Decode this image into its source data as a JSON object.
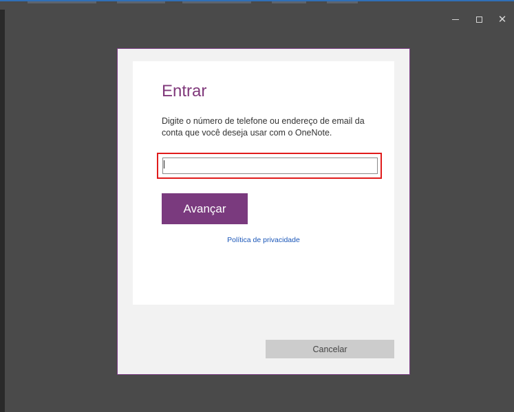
{
  "window": {
    "controls": {
      "minimize": "minimize-icon",
      "maximize": "maximize-icon",
      "close": "close-icon"
    }
  },
  "signin": {
    "title": "Entrar",
    "description": "Digite o número de telefone ou endereço de email da conta que você deseja usar com o OneNote.",
    "input_value": "",
    "next_label": "Avançar",
    "privacy_label": "Política de privacidade",
    "cancel_label": "Cancelar"
  },
  "colors": {
    "accent": "#7a3a7e",
    "title": "#80397b",
    "highlight": "#e01b1b",
    "link": "#1a56b8",
    "backdrop": "#4a4a4a"
  }
}
